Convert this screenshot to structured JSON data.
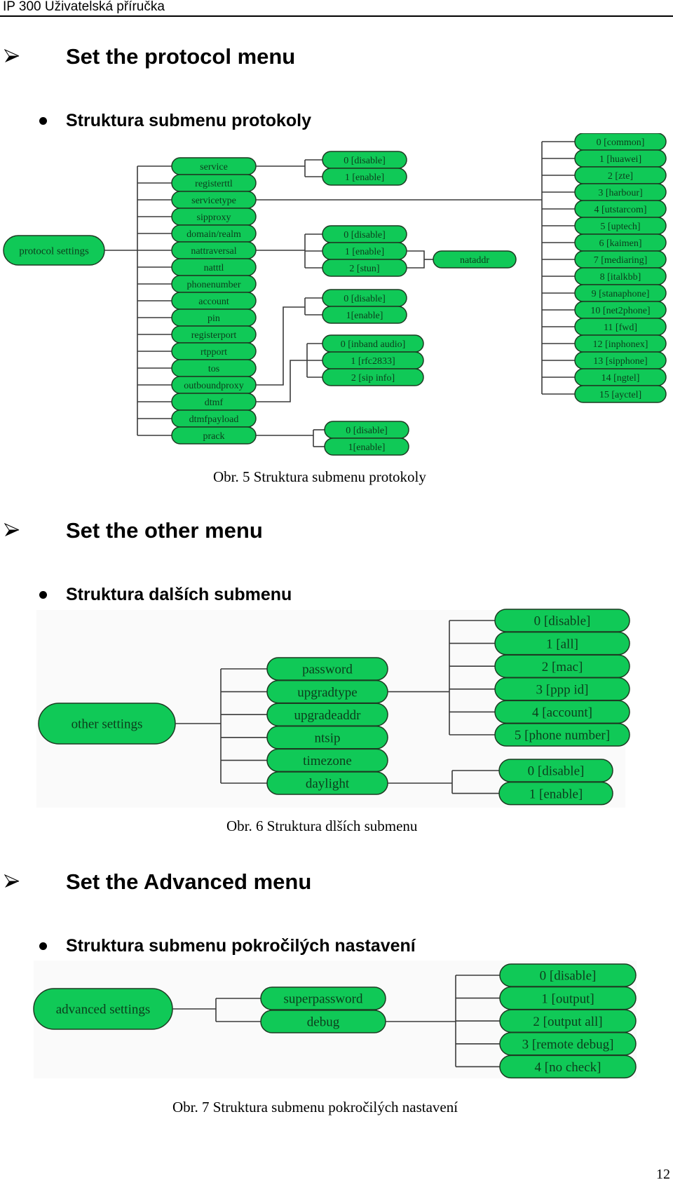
{
  "header": {
    "title": "IP 300 Uživatelská příručka"
  },
  "page_number": "12",
  "colors": {
    "node_fill": "#10c957",
    "node_stroke": "#1d3b22",
    "node_text": "#0c3d1c",
    "line": "#3a3a3a"
  },
  "sections": [
    {
      "heading": "Set the protocol menu",
      "subheading": "Struktura submenu protokoly",
      "caption": "Obr. 5 Struktura submenu protokoly",
      "diagram": {
        "root": "protocol settings",
        "items": [
          "service",
          "registerttl",
          "servicetype",
          "sipproxy",
          "domain/realm",
          "nattraversal",
          "natttl",
          "phonenumber",
          "account",
          "pin",
          "registerport",
          "rtpport",
          "tos",
          "outboundproxy",
          "dtmf",
          "dtmfpayload",
          "prack"
        ],
        "branches": {
          "service": [
            "0 [disable]",
            "1 [enable]"
          ],
          "servicetype": [
            "0 [common]",
            "1 [huawei]",
            "2 [zte]",
            "3 [harbour]",
            "4 [utstarcom]",
            "5 [uptech]",
            "6 [kaimen]",
            "7 [mediaring]",
            "8 [italkbb]",
            "9 [stanaphone]",
            "10 [net2phone]",
            "11 [fwd]",
            "12 [inphonex]",
            "13 [sipphone]",
            "14 [ngtel]",
            "15 [ayctel]"
          ],
          "nattraversal": [
            "0 [disable]",
            "1 [enable]",
            "2 [stun]"
          ],
          "nattraversal_sub": "nataddr",
          "outboundproxy": [
            "0 [disable]",
            "1[enable]"
          ],
          "dtmf": [
            "0 [inband audio]",
            "1 [rfc2833]",
            "2 [sip info]"
          ],
          "prack": [
            "0 [disable]",
            "1[enable]"
          ]
        }
      }
    },
    {
      "heading": "Set the other menu",
      "subheading": "Struktura dalších submenu",
      "caption": "Obr. 6 Struktura dlších submenu",
      "diagram": {
        "root": "other settings",
        "items": [
          "password",
          "upgradtype",
          "upgradeaddr",
          "ntsip",
          "timezone",
          "daylight"
        ],
        "branches": {
          "upgradtype": [
            "0 [disable]",
            "1 [all]",
            "2 [mac]",
            "3 [ppp id]",
            "4 [account]",
            "5 [phone number]"
          ],
          "daylight": [
            "0 [disable]",
            "1 [enable]"
          ]
        }
      }
    },
    {
      "heading": "Set the Advanced menu",
      "subheading": "Struktura submenu pokročilých nastavení",
      "caption": "Obr. 7 Struktura submenu pokročilých nastavení",
      "diagram": {
        "root": "advanced settings",
        "items": [
          "superpassword",
          "debug"
        ],
        "branches": {
          "debug": [
            "0 [disable]",
            "1 [output]",
            "2 [output all]",
            "3 [remote debug]",
            "4 [no check]"
          ]
        }
      }
    }
  ]
}
